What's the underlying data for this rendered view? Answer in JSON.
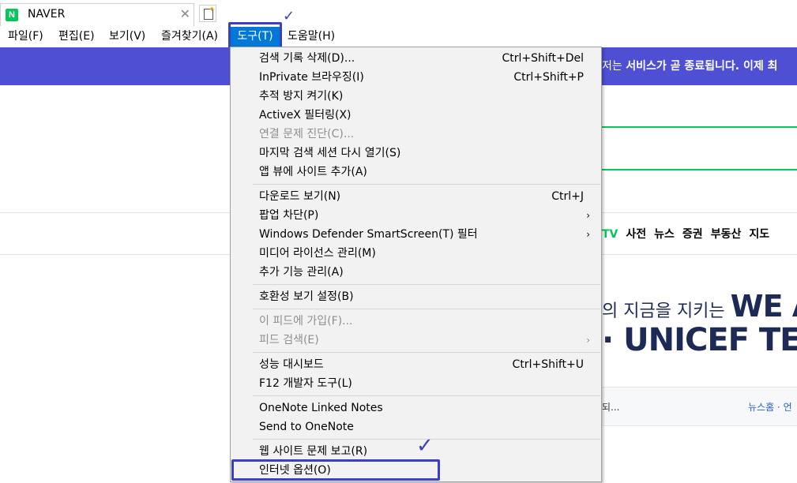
{
  "tab": {
    "favicon": "N",
    "title": "NAVER",
    "close": "✕"
  },
  "menubar": {
    "items": [
      "파일(F)",
      "편집(E)",
      "보기(V)",
      "즐겨찾기(A)",
      "도구(T)",
      "도움말(H)"
    ],
    "active": "도구(T)"
  },
  "annotations": {
    "check_mark": "✓",
    "color": "#3b3fc4"
  },
  "page": {
    "banner_text_1": "저는 ",
    "banner_text_2": "서비스가 곧 종료됩니다.",
    "banner_text_3": " 이제 최",
    "nav": [
      "TV",
      "사전",
      "뉴스",
      "증권",
      "부동산",
      "지도"
    ],
    "ad_line1_small": "의 지금을 지키는 ",
    "ad_line1_big": "WE A",
    "ad_line2": "· UNICEF TEA",
    "news_left": "되...",
    "news_home": "뉴스홈 · 언"
  },
  "tools_menu": {
    "groups": [
      [
        {
          "label": "검색 기록 삭제(D)...",
          "shortcut": "Ctrl+Shift+Del"
        },
        {
          "label": "InPrivate 브라우징(I)",
          "shortcut": "Ctrl+Shift+P"
        },
        {
          "label": "추적 방지 켜기(K)",
          "shortcut": ""
        },
        {
          "label": "ActiveX 필터링(X)",
          "shortcut": ""
        },
        {
          "label": "연결 문제 진단(C)...",
          "shortcut": "",
          "disabled": true
        },
        {
          "label": "마지막 검색 세션 다시 열기(S)",
          "shortcut": ""
        },
        {
          "label": "앱 뷰에 사이트 추가(A)",
          "shortcut": ""
        }
      ],
      [
        {
          "label": "다운로드 보기(N)",
          "shortcut": "Ctrl+J"
        },
        {
          "label": "팝업 차단(P)",
          "shortcut": "",
          "submenu": true
        },
        {
          "label": "Windows Defender SmartScreen(T) 필터",
          "shortcut": "",
          "submenu": true
        },
        {
          "label": "미디어 라이선스 관리(M)",
          "shortcut": ""
        },
        {
          "label": "추가 기능 관리(A)",
          "shortcut": ""
        }
      ],
      [
        {
          "label": "호환성 보기 설정(B)",
          "shortcut": ""
        }
      ],
      [
        {
          "label": "이 피드에 가입(F)...",
          "shortcut": "",
          "disabled": true
        },
        {
          "label": "피드 검색(E)",
          "shortcut": "",
          "disabled": true,
          "submenu": true
        }
      ],
      [
        {
          "label": "성능 대시보드",
          "shortcut": "Ctrl+Shift+U"
        },
        {
          "label": "F12 개발자 도구(L)",
          "shortcut": ""
        }
      ],
      [
        {
          "label": "OneNote Linked Notes",
          "shortcut": ""
        },
        {
          "label": "Send to OneNote",
          "shortcut": ""
        }
      ],
      [
        {
          "label": "웹 사이트 문제 보고(R)",
          "shortcut": ""
        },
        {
          "label": "인터넷 옵션(O)",
          "shortcut": "",
          "highlighted": true
        }
      ]
    ],
    "submenu_arrow": "›"
  }
}
